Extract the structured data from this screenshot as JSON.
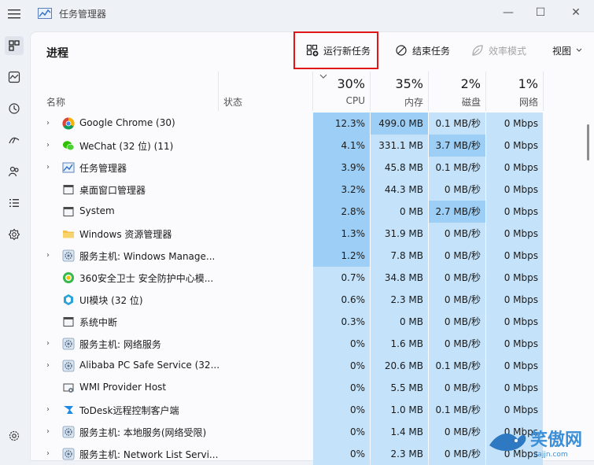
{
  "window": {
    "title": "任务管理器",
    "minimize": "—",
    "maximize": "☐",
    "close": "✕"
  },
  "nav": {
    "items": [
      "processes",
      "performance",
      "app-history",
      "startup",
      "users",
      "details",
      "services"
    ],
    "settings": "settings"
  },
  "toolbar": {
    "page_title": "进程",
    "run_new_task": "运行新任务",
    "end_task": "结束任务",
    "efficiency_mode": "效率模式",
    "view": "视图"
  },
  "columns": {
    "name": "名称",
    "status": "状态",
    "cpu": {
      "pct": "30%",
      "label": "CPU"
    },
    "memory": {
      "pct": "35%",
      "label": "内存"
    },
    "disk": {
      "pct": "2%",
      "label": "磁盘"
    },
    "network": {
      "pct": "1%",
      "label": "网络"
    }
  },
  "processes": [
    {
      "name": "Google Chrome (30)",
      "icon": "chrome",
      "expandable": true,
      "cpu": "12.3%",
      "mem": "499.0 MB",
      "disk": "0.1 MB/秒",
      "net": "0 Mbps"
    },
    {
      "name": "WeChat (32 位) (11)",
      "icon": "wechat",
      "expandable": true,
      "cpu": "4.1%",
      "mem": "331.1 MB",
      "disk": "3.7 MB/秒",
      "net": "0 Mbps"
    },
    {
      "name": "任务管理器",
      "icon": "taskmgr",
      "expandable": true,
      "cpu": "3.9%",
      "mem": "45.8 MB",
      "disk": "0.1 MB/秒",
      "net": "0 Mbps"
    },
    {
      "name": "桌面窗口管理器",
      "icon": "window",
      "expandable": false,
      "cpu": "3.2%",
      "mem": "44.3 MB",
      "disk": "0 MB/秒",
      "net": "0 Mbps"
    },
    {
      "name": "System",
      "icon": "window",
      "expandable": false,
      "cpu": "2.8%",
      "mem": "0 MB",
      "disk": "2.7 MB/秒",
      "net": "0 Mbps"
    },
    {
      "name": "Windows 资源管理器",
      "icon": "folder",
      "expandable": false,
      "cpu": "1.3%",
      "mem": "31.9 MB",
      "disk": "0 MB/秒",
      "net": "0 Mbps"
    },
    {
      "name": "服务主机: Windows Manage...",
      "icon": "gear",
      "expandable": true,
      "cpu": "1.2%",
      "mem": "7.8 MB",
      "disk": "0 MB/秒",
      "net": "0 Mbps"
    },
    {
      "name": "360安全卫士 安全防护中心模...",
      "icon": "360",
      "expandable": false,
      "cpu": "0.7%",
      "mem": "34.8 MB",
      "disk": "0 MB/秒",
      "net": "0 Mbps"
    },
    {
      "name": "UI模块 (32 位)",
      "icon": "ui",
      "expandable": false,
      "cpu": "0.6%",
      "mem": "2.3 MB",
      "disk": "0 MB/秒",
      "net": "0 Mbps"
    },
    {
      "name": "系统中断",
      "icon": "window",
      "expandable": false,
      "cpu": "0.3%",
      "mem": "0 MB",
      "disk": "0 MB/秒",
      "net": "0 Mbps"
    },
    {
      "name": "服务主机: 网络服务",
      "icon": "gear",
      "expandable": true,
      "cpu": "0%",
      "mem": "1.6 MB",
      "disk": "0 MB/秒",
      "net": "0 Mbps"
    },
    {
      "name": "Alibaba PC Safe Service (32...",
      "icon": "gear",
      "expandable": true,
      "cpu": "0%",
      "mem": "20.6 MB",
      "disk": "0.1 MB/秒",
      "net": "0 Mbps"
    },
    {
      "name": "WMI Provider Host",
      "icon": "wmi",
      "expandable": false,
      "cpu": "0%",
      "mem": "5.5 MB",
      "disk": "0 MB/秒",
      "net": "0 Mbps"
    },
    {
      "name": "ToDesk远程控制客户端",
      "icon": "todesk",
      "expandable": true,
      "cpu": "0%",
      "mem": "1.0 MB",
      "disk": "0.1 MB/秒",
      "net": "0 Mbps"
    },
    {
      "name": "服务主机: 本地服务(网络受限)",
      "icon": "gear",
      "expandable": true,
      "cpu": "0%",
      "mem": "1.4 MB",
      "disk": "0 MB/秒",
      "net": "0 Mbps"
    },
    {
      "name": "服务主机: Network List Servi...",
      "icon": "gear",
      "expandable": true,
      "cpu": "0%",
      "mem": "2.3 MB",
      "disk": "0 MB/秒",
      "net": "0 Mbps"
    }
  ],
  "heat_colors": {
    "high": "#9dcff6",
    "low": "#c4e3fa",
    "none": "#fbfbfd"
  },
  "watermark": {
    "text": "笑傲网",
    "sub": "xajjn.com"
  }
}
